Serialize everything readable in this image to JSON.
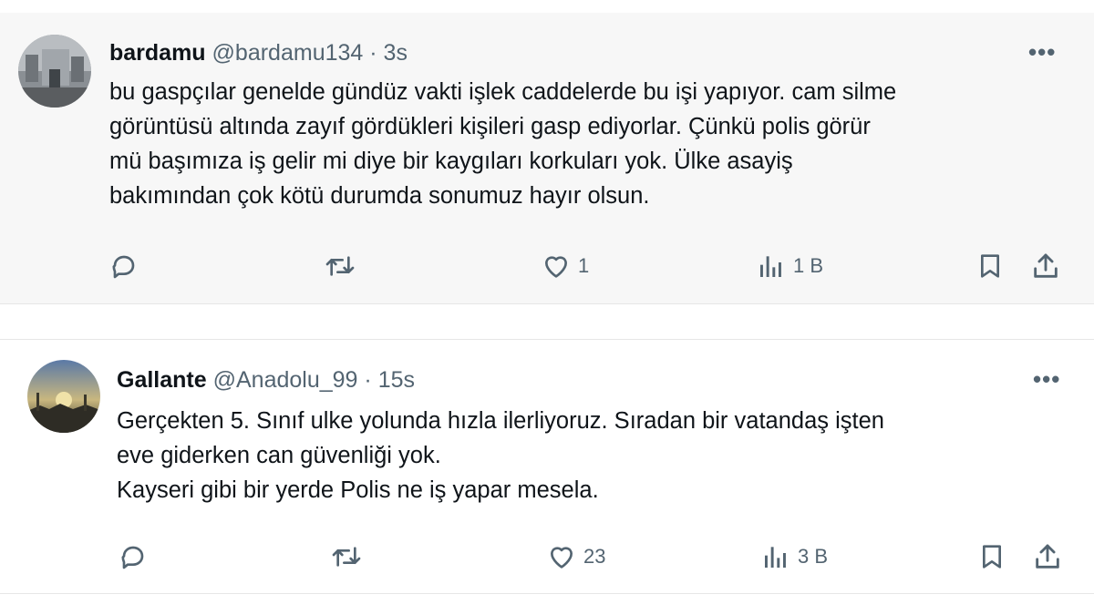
{
  "tweets": [
    {
      "name": "bardamu",
      "handle": "@bardamu134",
      "separator": "·",
      "time": "3s",
      "more_label": "•••",
      "lines": [
        "bu gaspçılar genelde gündüz vakti işlek caddelerde bu işi yapıyor. cam silme",
        "görüntüsü altında zayıf gördükleri kişileri gasp ediyorlar. Çünkü polis görür",
        "mü başımıza iş gelir mi diye bir kaygıları korkuları yok.  Ülke asayiş",
        "bakımından çok kötü durumda sonumuz hayır olsun."
      ],
      "likes": "1",
      "views": "1 B"
    },
    {
      "name": "Gallante",
      "handle": "@Anadolu_99",
      "separator": "·",
      "time": "15s",
      "more_label": "•••",
      "lines": [
        "Gerçekten 5. Sınıf ulke yolunda hızla ilerliyoruz. Sıradan bir vatandaş işten",
        "eve giderken can güvenliği yok.",
        "Kayseri gibi bir yerde Polis ne iş yapar mesela."
      ],
      "likes": "23",
      "views": "3 B"
    }
  ],
  "icons": {
    "reply": "reply-icon",
    "repost": "repost-icon",
    "like": "heart-icon",
    "views": "views-chart-icon",
    "bookmark": "bookmark-icon",
    "share": "share-icon"
  },
  "colors": {
    "text": "#0f1419",
    "muted": "#536471",
    "band": "#f7f7f7"
  }
}
